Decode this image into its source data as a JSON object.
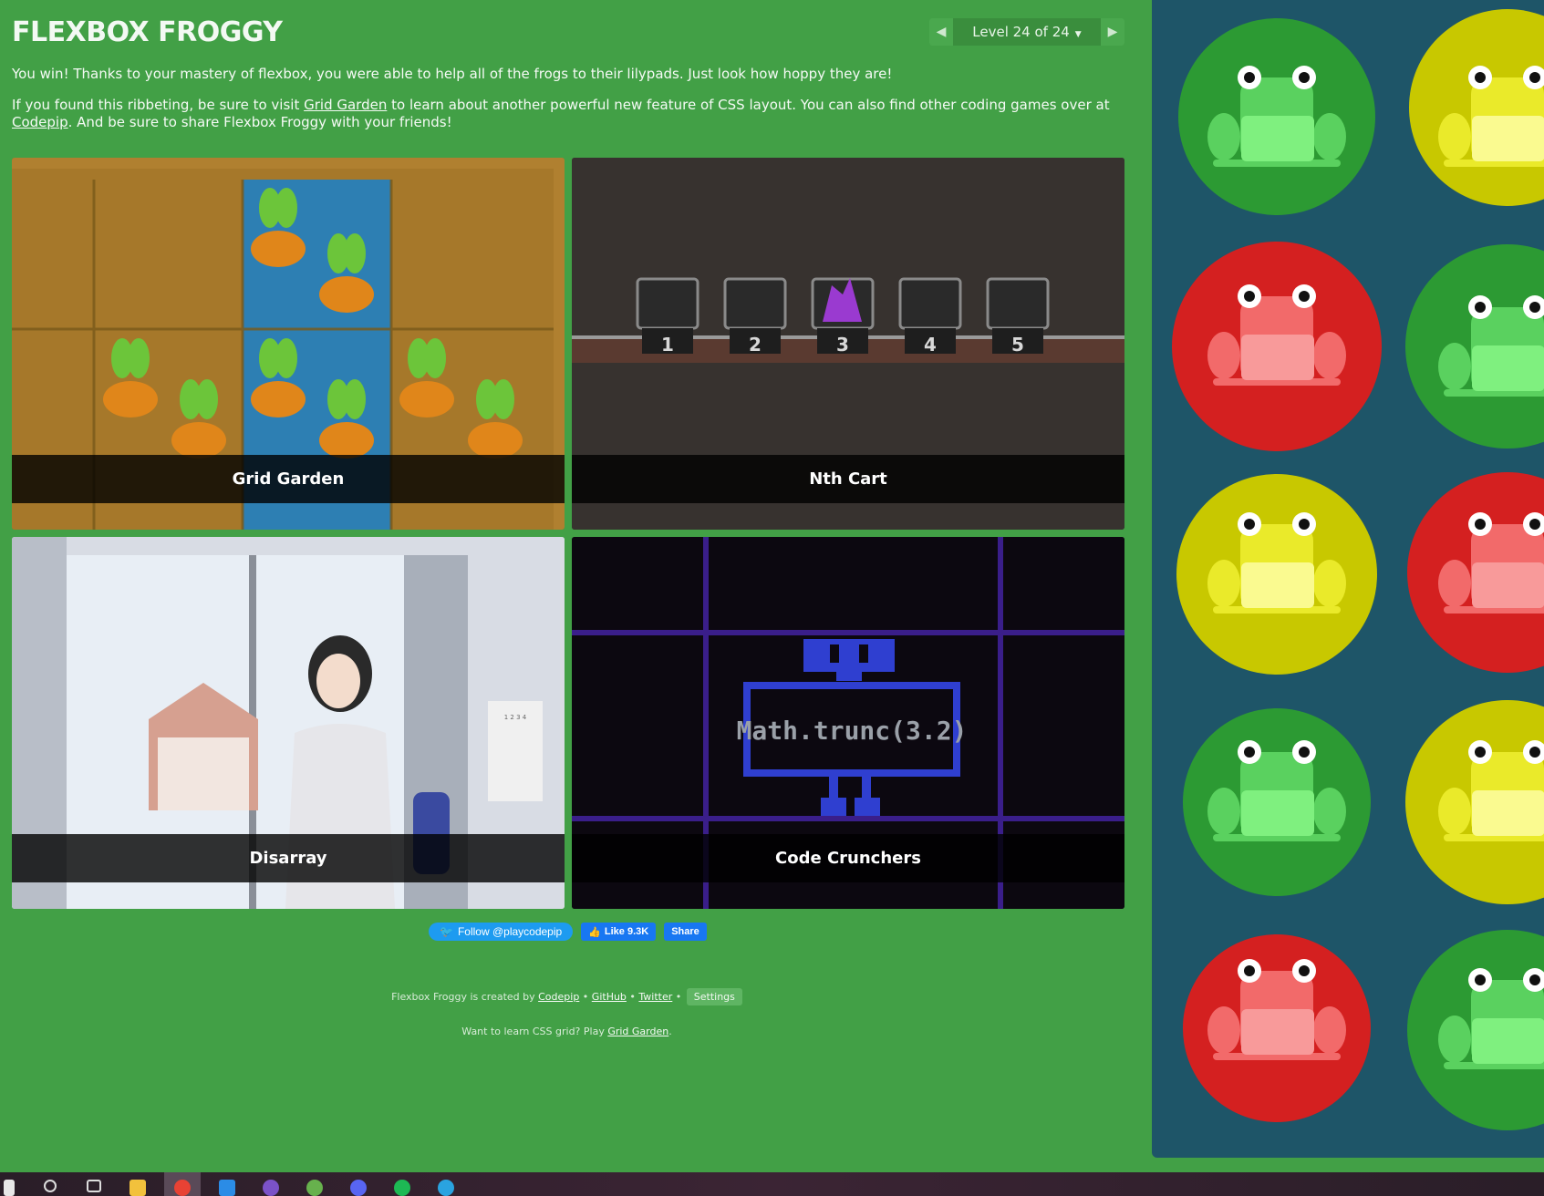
{
  "header": {
    "title": "FLEXBOX FROGGY",
    "level_label": "Level 24 of 24",
    "prev_icon": "triangle-left-icon",
    "next_icon": "triangle-right-icon",
    "caret_icon": "caret-down-icon"
  },
  "intro": {
    "win_text": "You win! Thanks to your mastery of flexbox, you were able to help all of the frogs to their lilypads. Just look how hoppy they are!",
    "p2_part1": "If you found this ribbeting, be sure to visit ",
    "p2_link1": "Grid Garden",
    "p2_part2": " to learn about another powerful new feature of CSS layout. You can also find other coding games over at ",
    "p2_link2": "Codepip",
    "p2_part3": ". And be sure to share Flexbox Froggy with your friends!"
  },
  "games": [
    {
      "name": "Grid Garden"
    },
    {
      "name": "Nth Cart"
    },
    {
      "name": "Disarray"
    },
    {
      "name": "Code Crunchers"
    }
  ],
  "nth_cart": {
    "cart_numbers": [
      "1",
      "2",
      "3",
      "4",
      "5"
    ]
  },
  "code_crunchers": {
    "expression": "Math.trunc(3.2)"
  },
  "disarray": {
    "calendar_text": "1 2 3 4"
  },
  "social": {
    "twitter_label": "Follow @playcodepip",
    "fb_like_label": "Like 9.3K",
    "fb_share_label": "Share"
  },
  "footer": {
    "created_by": "Flexbox Froggy is created by ",
    "codepip": "Codepip",
    "sep": " • ",
    "github": "GitHub",
    "twitter": "Twitter",
    "settings": "Settings",
    "cta_text": "Want to learn CSS grid? Play ",
    "cta_link": "Grid Garden",
    "cta_end": "."
  },
  "colors": {
    "background": "#42a046",
    "board": "#1e5568",
    "frog_green": "#5ad15f",
    "frog_yellow": "#eaea2a",
    "frog_red": "#f26a6a"
  },
  "taskbar": {
    "icons": [
      "windows-start-icon",
      "search-icon",
      "task-view-icon",
      "file-explorer-icon",
      "chrome-icon",
      "vscode-icon",
      "viber-icon",
      "utorrent-icon",
      "discord-icon",
      "spotify-icon",
      "telegram-icon"
    ]
  }
}
